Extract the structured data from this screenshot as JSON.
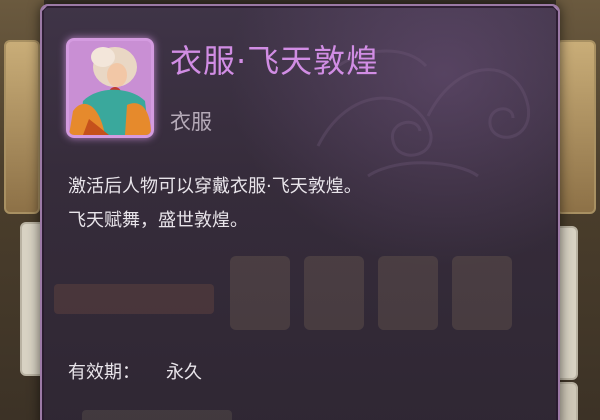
{
  "tooltip": {
    "title": "衣服·飞天敦煌",
    "type": "衣服",
    "description_lines": [
      "激活后人物可以穿戴衣服·飞天敦煌。",
      "飞天赋舞，盛世敦煌。"
    ],
    "validity_label": "有效期：",
    "validity_value": "永久",
    "icon": "costume-portrait-icon",
    "colors": {
      "title": "#d18de4",
      "rarity_frame": "#d49be0",
      "panel_border": "#9c7aa6"
    }
  }
}
